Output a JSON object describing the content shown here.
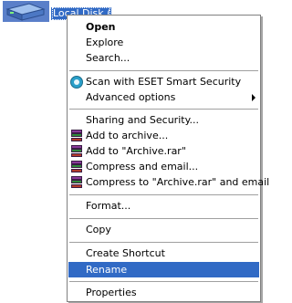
{
  "desktop": {
    "drive_label": "Local Disk (C:)"
  },
  "context_menu": {
    "open": "Open",
    "explore": "Explore",
    "search": "Search...",
    "eset_scan": "Scan with ESET Smart Security",
    "advanced_options": "Advanced options",
    "sharing_security": "Sharing and Security...",
    "add_to_archive": "Add to archive...",
    "add_to_archive_rar": "Add to \"Archive.rar\"",
    "compress_email": "Compress and email...",
    "compress_rar_email": "Compress to \"Archive.rar\" and email",
    "format": "Format...",
    "copy": "Copy",
    "create_shortcut": "Create Shortcut",
    "rename": "Rename",
    "properties": "Properties"
  },
  "colors": {
    "selection": "#316ac5",
    "separator": "#a0a0a0"
  }
}
